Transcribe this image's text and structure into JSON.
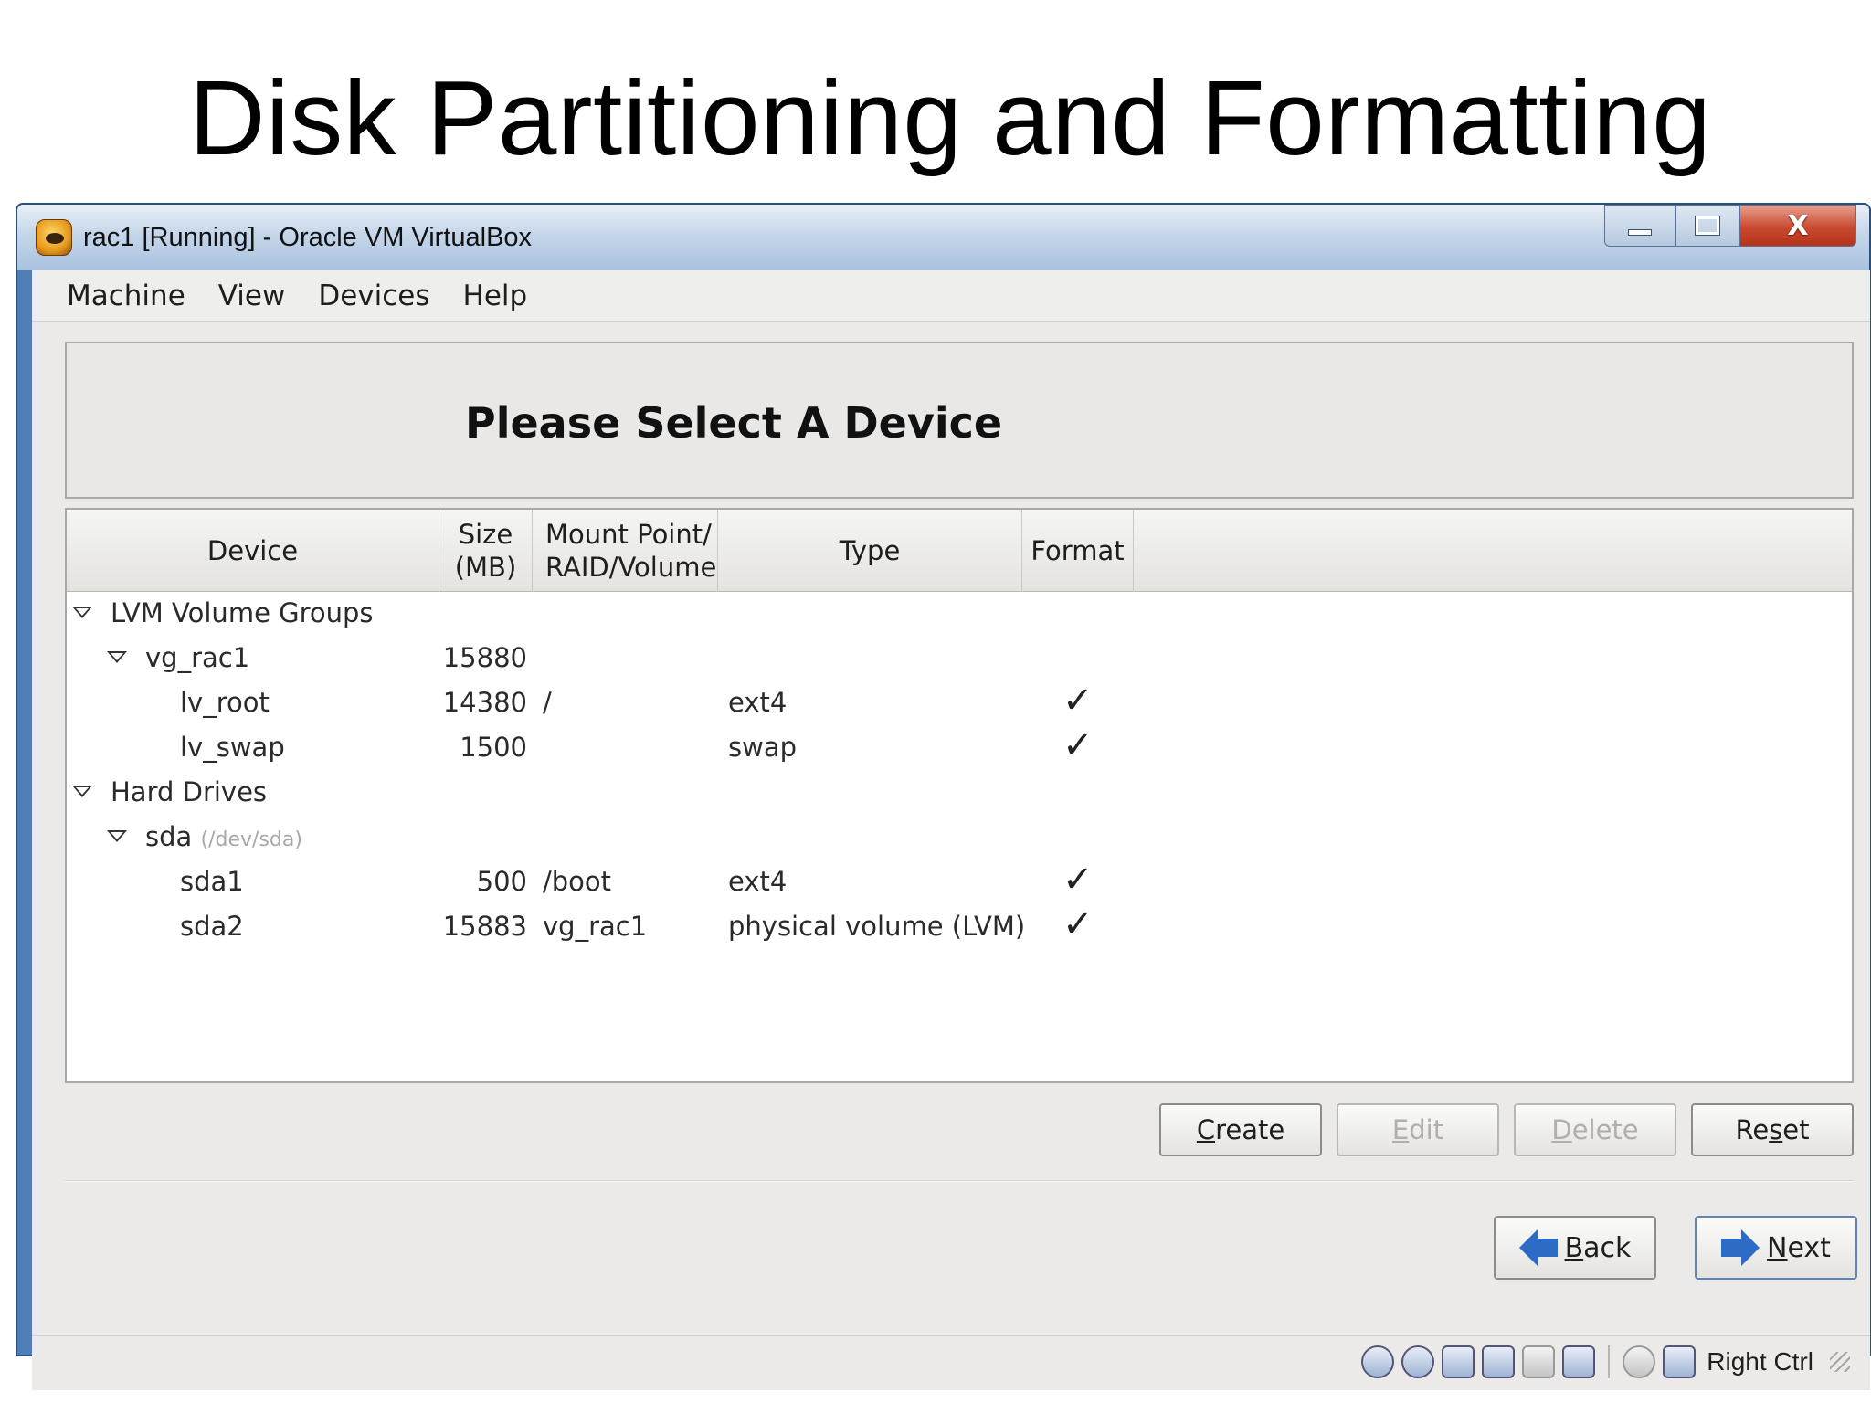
{
  "slide": {
    "title": "Disk Partitioning and Formatting"
  },
  "window": {
    "title": "rac1 [Running] - Oracle VM VirtualBox",
    "icon": "virtualbox-app-icon",
    "controls": {
      "minimize": "minimize-icon",
      "maximize": "maximize-icon",
      "close_label": "X"
    }
  },
  "menubar": {
    "items": [
      "Machine",
      "View",
      "Devices",
      "Help"
    ]
  },
  "header": {
    "title": "Please Select A Device"
  },
  "table": {
    "columns": {
      "device": "Device",
      "size_line1": "Size",
      "size_line2": "(MB)",
      "mount_line1": "Mount Point/",
      "mount_line2": "RAID/Volume",
      "type": "Type",
      "format": "Format"
    },
    "rows": [
      {
        "device": "LVM Volume Groups",
        "level": 0,
        "expanded": true,
        "size": "",
        "mount": "",
        "type": "",
        "format": false
      },
      {
        "device": "vg_rac1",
        "level": 1,
        "expanded": true,
        "size": "15880",
        "mount": "",
        "type": "",
        "format": false
      },
      {
        "device": "lv_root",
        "level": 2,
        "size": "14380",
        "mount": "/",
        "type": "ext4",
        "format": true
      },
      {
        "device": "lv_swap",
        "level": 2,
        "size": "1500",
        "mount": "",
        "type": "swap",
        "format": true
      },
      {
        "device": "Hard Drives",
        "level": 0,
        "expanded": true,
        "size": "",
        "mount": "",
        "type": "",
        "format": false
      },
      {
        "device": "sda",
        "device_path": "(/dev/sda)",
        "level": 1,
        "expanded": true,
        "size": "",
        "mount": "",
        "type": "",
        "format": false
      },
      {
        "device": "sda1",
        "level": 2,
        "size": "500",
        "mount": "/boot",
        "type": "ext4",
        "format": true
      },
      {
        "device": "sda2",
        "level": 2,
        "size": "15883",
        "mount": "vg_rac1",
        "type": "physical volume (LVM)",
        "format": true
      }
    ],
    "check_glyph": "✓"
  },
  "actions": {
    "create": {
      "prefix": "",
      "mnemonic": "C",
      "rest": "reate",
      "enabled": true
    },
    "edit": {
      "prefix": "",
      "mnemonic": "E",
      "rest": "dit",
      "enabled": false
    },
    "delete": {
      "prefix": "",
      "mnemonic": "D",
      "rest": "elete",
      "enabled": false
    },
    "reset": {
      "prefix": "Re",
      "mnemonic": "s",
      "rest": "et",
      "enabled": true
    }
  },
  "navigation": {
    "back": {
      "mnemonic": "B",
      "rest": "ack",
      "icon": "arrow-left-icon"
    },
    "next": {
      "mnemonic": "N",
      "rest": "ext",
      "icon": "arrow-right-icon"
    }
  },
  "statusbar": {
    "icons": [
      "hard-disk-icon",
      "optical-drive-icon",
      "usb-icon",
      "network-icon",
      "shared-folder-icon",
      "virtualization-icon",
      "mouse-integration-icon",
      "host-key-icon"
    ],
    "host_key": "Right Ctrl"
  },
  "colors": {
    "window_frame": "#4f7fb7",
    "arrow": "#2d6bc4",
    "close_button": "#c84a30"
  }
}
